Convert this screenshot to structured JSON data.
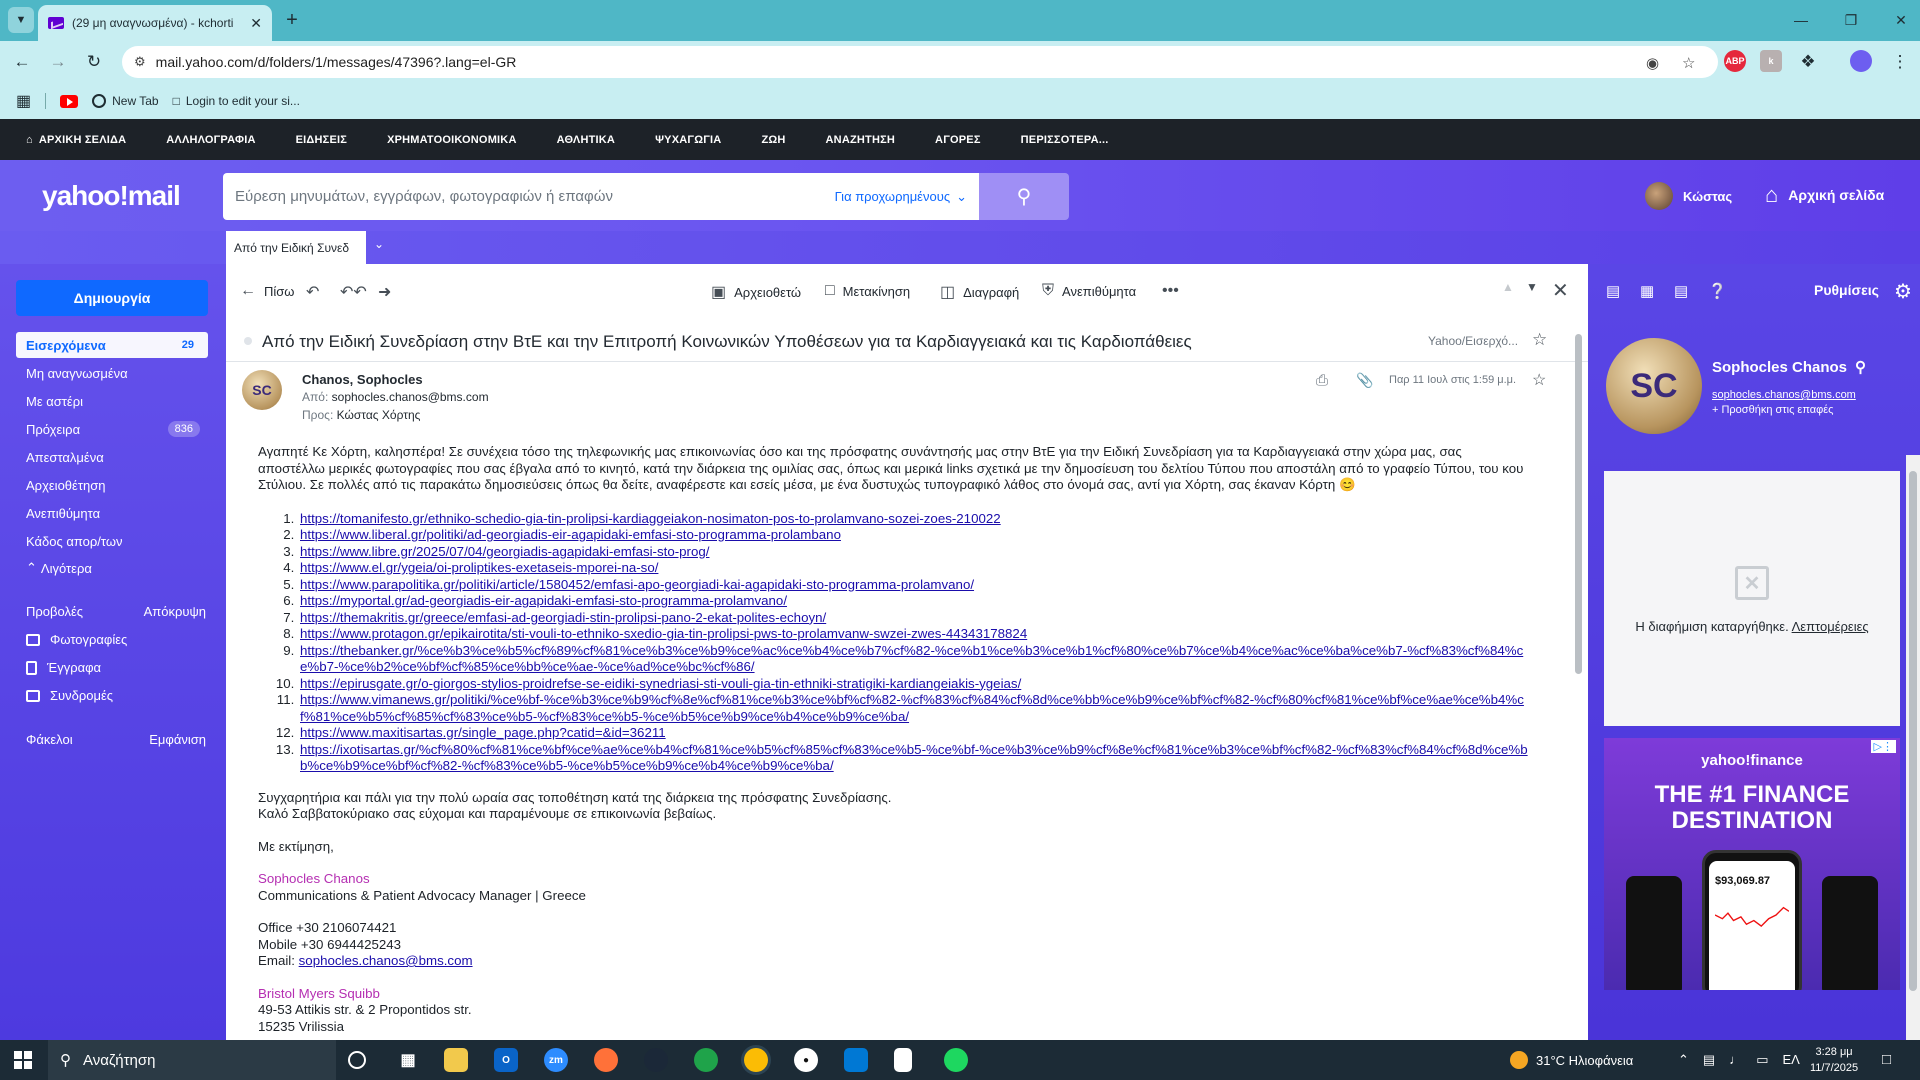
{
  "browser": {
    "tab_title": "(29 μη αναγνωσμένα) - kchorti",
    "url": "mail.yahoo.com/d/folders/1/messages/47396?.lang=el-GR",
    "bookmarks": [
      "New Tab",
      "Login to edit your si..."
    ]
  },
  "ynav": {
    "items": [
      "ΑΡΧΙΚΗ ΣΕΛΙΔΑ",
      "ΑΛΛΗΛΟΓΡΑΦΙΑ",
      "ΕΙΔΗΣΕΙΣ",
      "ΧΡΗΜΑΤΟΟΙΚΟΝΟΜΙΚΑ",
      "ΑΘΛΗΤΙΚΑ",
      "ΨΥΧΑΓΩΓΙΑ",
      "ΖΩΗ",
      "ΑΝΑΖΗΤΗΣΗ",
      "ΑΓΟΡΕΣ",
      "ΠΕΡΙΣΣΟΤΕΡΑ..."
    ]
  },
  "header": {
    "logo": "yahoo!mail",
    "search_placeholder": "Εύρεση μηνυμάτων, εγγράφων, φωτογραφιών ή επαφών",
    "advanced": "Για προχωρημένους",
    "user_name": "Κώστας",
    "home_label": "Αρχική σελίδα"
  },
  "subtab": {
    "label": "Από την Ειδική Συνεδ"
  },
  "sidebar": {
    "compose": "Δημιουργία",
    "folders": [
      {
        "label": "Εισερχόμενα",
        "count": "29"
      },
      {
        "label": "Μη αναγνωσμένα",
        "count": ""
      },
      {
        "label": "Με αστέρι",
        "count": ""
      },
      {
        "label": "Πρόχειρα",
        "count": "836"
      },
      {
        "label": "Απεσταλμένα",
        "count": ""
      },
      {
        "label": "Αρχειοθέτηση",
        "count": ""
      },
      {
        "label": "Ανεπιθύμητα",
        "count": ""
      },
      {
        "label": "Κάδος απορ/των",
        "count": ""
      }
    ],
    "less": "Λιγότερα",
    "views_label": "Προβολές",
    "views_hide": "Απόκρυψη",
    "views": [
      "Φωτογραφίες",
      "Έγγραφα",
      "Συνδρομές"
    ],
    "folders_label": "Φάκελοι",
    "folders_show": "Εμφάνιση"
  },
  "toolbar": {
    "back": "Πίσω",
    "archive": "Αρχειοθετώ",
    "move": "Μετακίνηση",
    "delete": "Διαγραφή",
    "spam": "Ανεπιθύμητα"
  },
  "message": {
    "subject": "Από την Ειδική Συνεδρίαση στην ΒτΕ και την Επιτροπή Κοινωνικών Υποθέσεων για τα Καρδιαγγειακά και τις Καρδιοπάθειες",
    "folder": "Yahoo/Εισερχό...",
    "sender_initials": "SC",
    "sender_name": "Chanos, Sophocles",
    "from_label": "Από:",
    "from": "sophocles.chanos@bms.com",
    "to_label": "Προς:",
    "to": "Κώστας Χόρτης",
    "date": "Παρ 11 Ιουλ στις 1:59 μ.μ.",
    "intro": "Αγαπητέ Κε Χόρτη, καλησπέρα! Σε συνέχεια τόσο της τηλεφωνικής μας επικοινωνίας όσο και της πρόσφατης συνάντησής μας στην ΒτΕ για την Ειδική Συνεδρίαση για τα Καρδιαγγειακά στην χώρα μας, σας αποστέλλω μερικές φωτογραφίες που σας έβγαλα από το κινητό, κατά την διάρκεια της ομιλίας σας, όπως και μερικά links σχετικά με την δημοσίευση του δελτίου Τύπου που αποστάλη από το γραφείο Τύπου, του κου Στύλιου. Σε πολλές από τις παρακάτω δημοσιεύσεις όπως θα δείτε, αναφέρεστε και εσείς μέσα, με ένα δυστυχώς τυπογραφικό λάθος στο όνομά σας, αντί για Χόρτη, σας έκαναν Κόρτη 😊",
    "links": [
      "https://tomanifesto.gr/ethniko-schedio-gia-tin-prolipsi-kardiaggeiakon-nosimaton-pos-to-prolamvano-sozei-zoes-210022",
      "https://www.liberal.gr/politiki/ad-georgiadis-eir-agapidaki-emfasi-sto-programma-prolambano",
      "https://www.libre.gr/2025/07/04/georgiadis-agapidaki-emfasi-sto-prog/",
      "https://www.el.gr/ygeia/oi-proliptikes-exetaseis-mporei-na-so/",
      "https://www.parapolitika.gr/politiki/article/1580452/emfasi-apo-georgiadi-kai-agapidaki-sto-programma-prolamvano/",
      "https://myportal.gr/ad-georgiadis-eir-agapidaki-emfasi-sto-programma-prolamvano/",
      "https://themakritis.gr/greece/emfasi-ad-georgiadi-stin-prolipsi-pano-2-ekat-polites-echoyn/",
      "https://www.protagon.gr/epikairotita/sti-vouli-to-ethniko-sxedio-gia-tin-prolipsi-pws-to-prolamvanw-swzei-zwes-44343178824",
      "https://thebanker.gr/%ce%b3%ce%b5%cf%89%cf%81%ce%b3%ce%b9%ce%ac%ce%b4%ce%b7%cf%82-%ce%b1%ce%b3%ce%b1%cf%80%ce%b7%ce%b4%ce%ac%ce%ba%ce%b7-%cf%83%cf%84%ce%b7-%ce%b2%ce%bf%cf%85%ce%bb%ce%ae-%ce%ad%ce%bc%cf%86/",
      "https://epirusgate.gr/o-giorgos-stylios-proidrefse-se-eidiki-synedriasi-sti-vouli-gia-tin-ethniki-stratigiki-kardiangeiakis-ygeias/",
      "https://www.vimanews.gr/politiki/%ce%bf-%ce%b3%ce%b9%cf%8e%cf%81%ce%b3%ce%bf%cf%82-%cf%83%cf%84%cf%8d%ce%bb%ce%b9%ce%bf%cf%82-%cf%80%cf%81%ce%bf%ce%ae%ce%b4%cf%81%ce%b5%cf%85%cf%83%ce%b5-%cf%83%ce%b5-%ce%b5%ce%b9%ce%b4%ce%b9%ce%ba/",
      "https://www.maxitisartas.gr/single_page.php?catid=&id=36211",
      "https://ixotisartas.gr/%cf%80%cf%81%ce%bf%ce%ae%ce%b4%cf%81%ce%b5%cf%85%cf%83%ce%b5-%ce%bf-%ce%b3%ce%b9%cf%8e%cf%81%ce%b3%ce%bf%cf%82-%cf%83%cf%84%cf%8d%ce%bb%ce%b9%ce%bf%cf%82-%cf%83%ce%b5-%ce%b5%ce%b9%ce%b4%ce%b9%ce%ba/"
    ],
    "congrats_1": "Συγχαρητήρια και πάλι για την πολύ ωραία σας τοποθέτηση κατά της διάρκεια της πρόσφατης Συνεδρίασης.",
    "congrats_2": "Καλό Σαββατοκύριακο σας εύχομαι και παραμένουμε σε επικοινωνία βεβαίως.",
    "regards": "Με εκτίμηση,",
    "sig_name": "Sophocles Chanos",
    "sig_title": "Communications & Patient Advocacy Manager | Greece",
    "sig_office": "Office +30 2106074421",
    "sig_mobile": "Mobile +30 6944425243",
    "sig_email_label": "Email:",
    "sig_email": "sophocles.chanos@bms.com",
    "sig_company": "Bristol Myers Squibb",
    "sig_address_1": "49-53 Attikis str. & 2 Propontidos str.",
    "sig_address_2": "15235 Vrilissia"
  },
  "rail": {
    "settings": "Ρυθμίσεις",
    "contact_initials": "SC",
    "contact_name": "Sophocles Chanos",
    "contact_email": "sophocles.chanos@bms.com",
    "contact_add": "+ Προσθήκη στις επαφές",
    "ad_disabled": "Η διαφήμιση καταργήθηκε.",
    "ad_details": "Λεπτομέρειες",
    "ad_brand": "yahoo!finance",
    "ad_headline": "THE #1 FINANCE DESTINATION",
    "ad_price": "$93,069.87"
  },
  "taskbar": {
    "search": "Αναζήτηση",
    "weather": "31°C Ηλιοφάνεια",
    "lang": "ΕΛ",
    "time": "3:28 μμ",
    "date": "11/7/2025"
  },
  "colors": {
    "yahoo_purple": "#6d5ef0",
    "compose_blue": "#0f69ff",
    "link": "#1a0dab",
    "signature": "#b52fb2"
  }
}
